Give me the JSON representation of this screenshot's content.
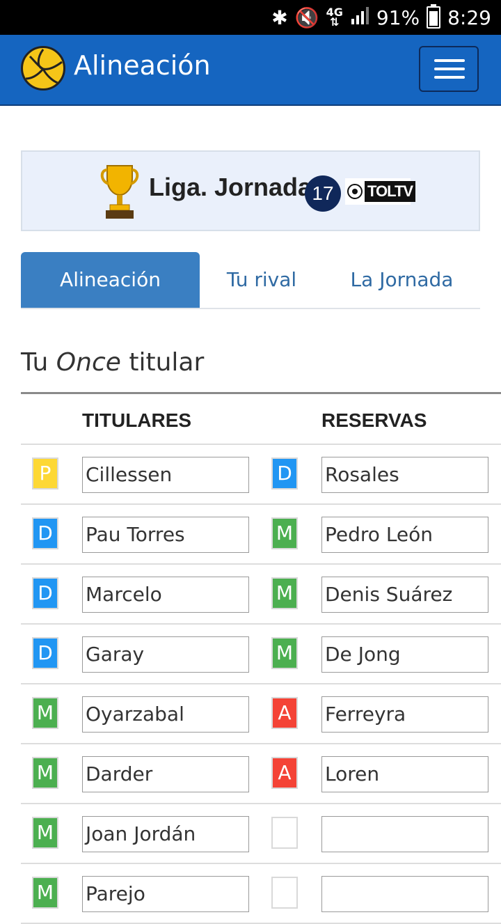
{
  "status_bar": {
    "battery": "91%",
    "time": "8:29",
    "network": "4G"
  },
  "navbar": {
    "title": "Alineación",
    "menu_icon": "hamburger-icon"
  },
  "banner": {
    "title": "Liga. Jornada",
    "jornada": "17",
    "tv_logo_text": "TOLTV"
  },
  "tabs": [
    {
      "label": "Alineación",
      "active": true
    },
    {
      "label": "Tu rival",
      "active": false
    },
    {
      "label": "La Jornada",
      "active": false
    }
  ],
  "section": {
    "title_pre": "Tu",
    "title_em": "Once",
    "title_post": "titular"
  },
  "table": {
    "headers": {
      "titulares": "TITULARES",
      "reservas": "RESERVAS"
    },
    "rows": [
      {
        "tit_pos": "P",
        "tit_name": "Cillessen",
        "res_pos": "D",
        "res_name": "Rosales"
      },
      {
        "tit_pos": "D",
        "tit_name": "Pau Torres",
        "res_pos": "M",
        "res_name": "Pedro León"
      },
      {
        "tit_pos": "D",
        "tit_name": "Marcelo",
        "res_pos": "M",
        "res_name": "Denis Suárez"
      },
      {
        "tit_pos": "D",
        "tit_name": "Garay",
        "res_pos": "M",
        "res_name": "De Jong"
      },
      {
        "tit_pos": "M",
        "tit_name": "Oyarzabal",
        "res_pos": "A",
        "res_name": "Ferreyra"
      },
      {
        "tit_pos": "M",
        "tit_name": "Darder",
        "res_pos": "A",
        "res_name": "Loren"
      },
      {
        "tit_pos": "M",
        "tit_name": "Joan Jordán",
        "res_pos": "",
        "res_name": ""
      },
      {
        "tit_pos": "M",
        "tit_name": "Parejo",
        "res_pos": "",
        "res_name": ""
      }
    ]
  },
  "colors": {
    "P": "#fdd835",
    "D": "#2196f3",
    "M": "#4caf50",
    "A": "#f44336",
    "navbar": "#1565c0"
  }
}
